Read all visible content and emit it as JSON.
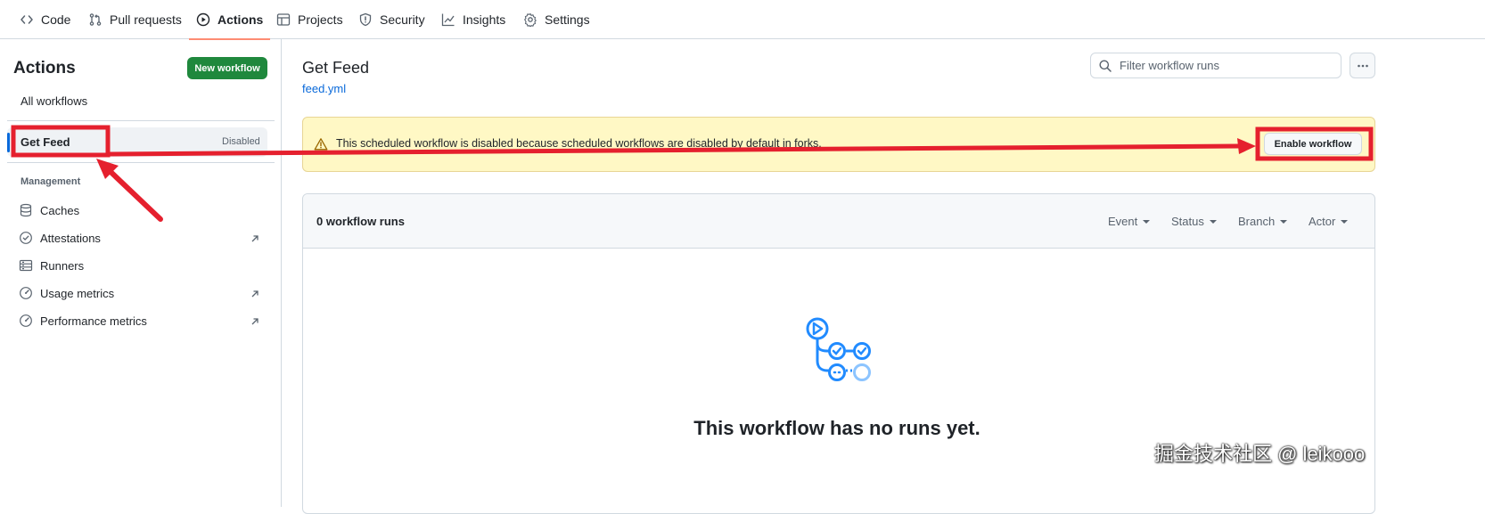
{
  "topnav": {
    "tabs": [
      {
        "label": "Code",
        "icon": "code-icon"
      },
      {
        "label": "Pull requests",
        "icon": "git-pull-request-icon"
      },
      {
        "label": "Actions",
        "icon": "play-icon",
        "active": true
      },
      {
        "label": "Projects",
        "icon": "table-icon"
      },
      {
        "label": "Security",
        "icon": "shield-icon"
      },
      {
        "label": "Insights",
        "icon": "graph-icon"
      },
      {
        "label": "Settings",
        "icon": "gear-icon"
      }
    ]
  },
  "sidebar": {
    "title": "Actions",
    "new_workflow_label": "New workflow",
    "all_workflows_label": "All workflows",
    "selected_workflow": {
      "label": "Get Feed",
      "status": "Disabled"
    },
    "management_heading": "Management",
    "management_items": [
      {
        "label": "Caches",
        "icon": "database-icon",
        "external": false
      },
      {
        "label": "Attestations",
        "icon": "verified-icon",
        "external": true
      },
      {
        "label": "Runners",
        "icon": "server-icon",
        "external": false
      },
      {
        "label": "Usage metrics",
        "icon": "meter-icon",
        "external": true
      },
      {
        "label": "Performance metrics",
        "icon": "meter-icon",
        "external": true
      }
    ]
  },
  "main": {
    "title": "Get Feed",
    "file_link": "feed.yml",
    "filter_placeholder": "Filter workflow runs",
    "warning": {
      "text": "This scheduled workflow is disabled because scheduled workflows are disabled by default in forks.",
      "button_label": "Enable workflow"
    },
    "runs": {
      "count_label": "0 workflow runs",
      "filters": [
        "Event",
        "Status",
        "Branch",
        "Actor"
      ],
      "empty_title": "This workflow has no runs yet."
    }
  },
  "watermark": "掘金技术社区 @ leikooo",
  "colors": {
    "accent": "#0969da",
    "primary_button": "#1f883d",
    "warning_bg": "#fff8c5",
    "annotation": "#e5202e",
    "active_tab_underline": "#fd8c73"
  }
}
